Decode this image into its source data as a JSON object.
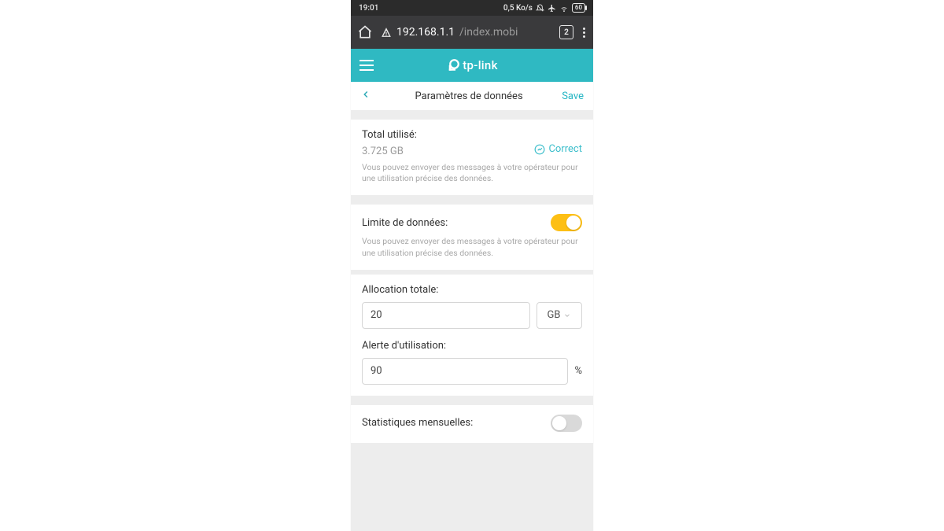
{
  "status_bar": {
    "time": "19:01",
    "data_rate": "0,5 Ko/s",
    "battery_text": "60"
  },
  "browser": {
    "url_host": "192.168.1.1",
    "url_path": "/index.mobi",
    "tab_count": "2"
  },
  "tpl": {
    "brand": "tp-link"
  },
  "page": {
    "title": "Paramètres de données",
    "save": "Save"
  },
  "total_used": {
    "label": "Total utilisé:",
    "value": "3.725 GB",
    "correct": "Correct",
    "desc": "Vous pouvez envoyer des messages à votre opérateur pour une utilisation précise des données."
  },
  "data_limit": {
    "label": "Limite de données:",
    "enabled": true,
    "desc": "Vous pouvez envoyer des messages à votre opérateur pour une utilisation précise des données."
  },
  "allocation": {
    "label": "Allocation totale:",
    "value": "20",
    "unit": "GB"
  },
  "alert": {
    "label": "Alerte d'utilisation:",
    "value": "90",
    "suffix": "%"
  },
  "monthly_stats": {
    "label": "Statistiques mensuelles:",
    "enabled": false
  }
}
